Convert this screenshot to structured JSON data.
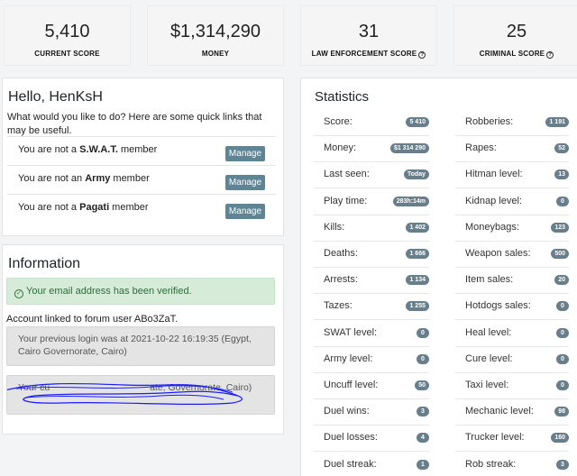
{
  "stats_bar": [
    {
      "value": "5,410",
      "label": "CURRENT SCORE",
      "help": false
    },
    {
      "value": "$1,314,290",
      "label": "MONEY",
      "help": false
    },
    {
      "value": "31",
      "label": "LAW ENFORCEMENT SCORE",
      "help": true
    },
    {
      "value": "25",
      "label": "CRIMINAL SCORE",
      "help": true
    }
  ],
  "hello": {
    "title": "Hello, HenKsH",
    "intro": "What would you like to do? Here are some quick links that may be useful.",
    "rows": [
      {
        "pre": "You are not a ",
        "group": "S.W.A.T.",
        "post": " member",
        "button": "Manage"
      },
      {
        "pre": "You are not an ",
        "group": "Army",
        "post": " member",
        "button": "Manage"
      },
      {
        "pre": "You are not a ",
        "group": "Pagati",
        "post": " member",
        "button": "Manage"
      }
    ]
  },
  "information": {
    "title": "Information",
    "verified": "Your email address has been verified.",
    "linked": "Account linked to forum user ABo3ZaT.",
    "previous_login": "Your previous login was at 2021-10-22 16:19:35 (Egypt, Cairo Governorate, Cairo)",
    "current_login_visible": "Your cu                                      ate, Governorate, Cairo)"
  },
  "statistics": {
    "title": "Statistics",
    "left": [
      {
        "label": "Score:",
        "value": "5 410"
      },
      {
        "label": "Money:",
        "value": "$1 314 290"
      },
      {
        "label": "Last seen:",
        "value": "Today"
      },
      {
        "label": "Play time:",
        "value": "283h:14m"
      },
      {
        "label": "Kills:",
        "value": "1 402"
      },
      {
        "label": "Deaths:",
        "value": "1 666"
      },
      {
        "label": "Arrests:",
        "value": "1 134"
      },
      {
        "label": "Tazes:",
        "value": "1 255"
      },
      {
        "label": "SWAT level:",
        "value": "0"
      },
      {
        "label": "Army level:",
        "value": "0"
      },
      {
        "label": "Uncuff level:",
        "value": "50"
      },
      {
        "label": "Duel wins:",
        "value": "3"
      },
      {
        "label": "Duel losses:",
        "value": "4"
      },
      {
        "label": "Duel streak:",
        "value": "1"
      }
    ],
    "right": [
      {
        "label": "Robberies:",
        "value": "1 191"
      },
      {
        "label": "Rapes:",
        "value": "52"
      },
      {
        "label": "Hitman level:",
        "value": "13"
      },
      {
        "label": "Kidnap level:",
        "value": "0"
      },
      {
        "label": "Moneybags:",
        "value": "123"
      },
      {
        "label": "Weapon sales:",
        "value": "500"
      },
      {
        "label": "Item sales:",
        "value": "20"
      },
      {
        "label": "Hotdogs sales:",
        "value": "0"
      },
      {
        "label": "Heal level:",
        "value": "0"
      },
      {
        "label": "Cure level:",
        "value": "0"
      },
      {
        "label": "Taxi level:",
        "value": "0"
      },
      {
        "label": "Mechanic level:",
        "value": "98"
      },
      {
        "label": "Trucker level:",
        "value": "160"
      },
      {
        "label": "Rob streak:",
        "value": "3"
      }
    ]
  },
  "colors": {
    "badge": "#687e8b",
    "manage_button": "#5f8594",
    "verified_bg": "#d6ecd9",
    "scribble": "#1a1aff"
  }
}
